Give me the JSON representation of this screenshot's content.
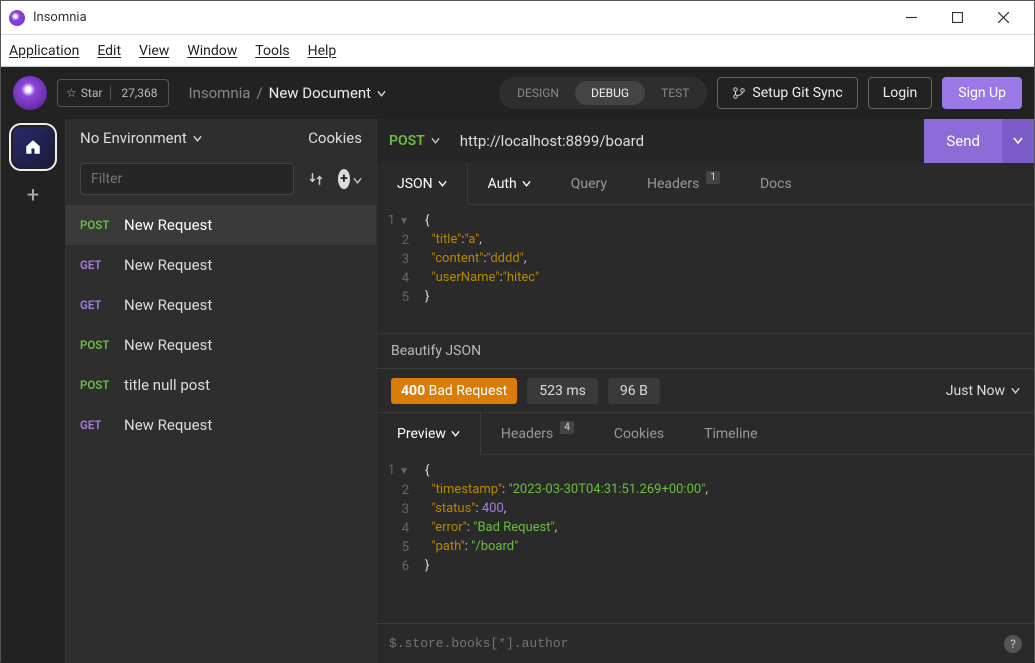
{
  "window": {
    "title": "Insomnia"
  },
  "menubar": [
    "Application",
    "Edit",
    "View",
    "Window",
    "Tools",
    "Help"
  ],
  "appbar": {
    "star": {
      "label": "Star",
      "count": "27,368"
    },
    "breadcrumb": {
      "parent": "Insomnia",
      "doc": "New Document"
    },
    "modes": {
      "design": "DESIGN",
      "debug": "DEBUG",
      "test": "TEST"
    },
    "git": "Setup Git Sync",
    "login": "Login",
    "signup": "Sign Up"
  },
  "sidebar": {
    "env": "No Environment",
    "cookies": "Cookies",
    "filter_placeholder": "Filter",
    "requests": [
      {
        "method": "POST",
        "mclass": "m-post",
        "name": "New Request",
        "active": true
      },
      {
        "method": "GET",
        "mclass": "m-get",
        "name": "New Request",
        "active": false
      },
      {
        "method": "GET",
        "mclass": "m-get",
        "name": "New Request",
        "active": false
      },
      {
        "method": "POST",
        "mclass": "m-post",
        "name": "New Request",
        "active": false
      },
      {
        "method": "POST",
        "mclass": "m-post",
        "name": "title null post",
        "active": false
      },
      {
        "method": "GET",
        "mclass": "m-get",
        "name": "New Request",
        "active": false
      }
    ]
  },
  "request": {
    "method": "POST",
    "url": "http://localhost:8899/board",
    "send": "Send",
    "tabs": {
      "body": "JSON",
      "auth": "Auth",
      "query": "Query",
      "headers": "Headers",
      "headers_badge": "1",
      "docs": "Docs"
    },
    "body_lines": [
      {
        "n": "1",
        "html": "<span class='brace'>{</span>"
      },
      {
        "n": "2",
        "html": "  <span class='key'>\"title\"</span><span class='punc'>:</span><span class='key'>\"a\"</span><span class='punc'>,</span>"
      },
      {
        "n": "3",
        "html": "  <span class='key'>\"content\"</span><span class='punc'>:</span><span class='key'>\"dddd\"</span><span class='punc'>,</span>"
      },
      {
        "n": "4",
        "html": "  <span class='key'>\"userName\"</span><span class='punc'>:</span><span class='key'>\"hitec\"</span>"
      },
      {
        "n": "5",
        "html": "<span class='brace'>}</span>"
      }
    ],
    "beautify": "Beautify JSON"
  },
  "response": {
    "status_code": "400",
    "status_text": "Bad Request",
    "time": "523 ms",
    "size": "96 B",
    "when": "Just Now",
    "tabs": {
      "preview": "Preview",
      "headers": "Headers",
      "headers_badge": "4",
      "cookies": "Cookies",
      "timeline": "Timeline"
    },
    "body_lines": [
      {
        "n": "1",
        "html": "<span class='brace'>{</span>"
      },
      {
        "n": "2",
        "html": "  <span class='key'>\"timestamp\"</span><span class='punc'>:</span> <span class='string'>\"2023-03-30T04:31:51.269+00:00\"</span><span class='punc'>,</span>"
      },
      {
        "n": "3",
        "html": "  <span class='key'>\"status\"</span><span class='punc'>:</span> <span class='num'>400</span><span class='punc'>,</span>"
      },
      {
        "n": "4",
        "html": "  <span class='key'>\"error\"</span><span class='punc'>:</span> <span class='string'>\"Bad Request\"</span><span class='punc'>,</span>"
      },
      {
        "n": "5",
        "html": "  <span class='key'>\"path\"</span><span class='punc'>:</span> <span class='string'>\"/board\"</span>"
      },
      {
        "n": "6",
        "html": "<span class='brace'>}</span>"
      }
    ],
    "filter_placeholder": "$.store.books[*].author"
  }
}
